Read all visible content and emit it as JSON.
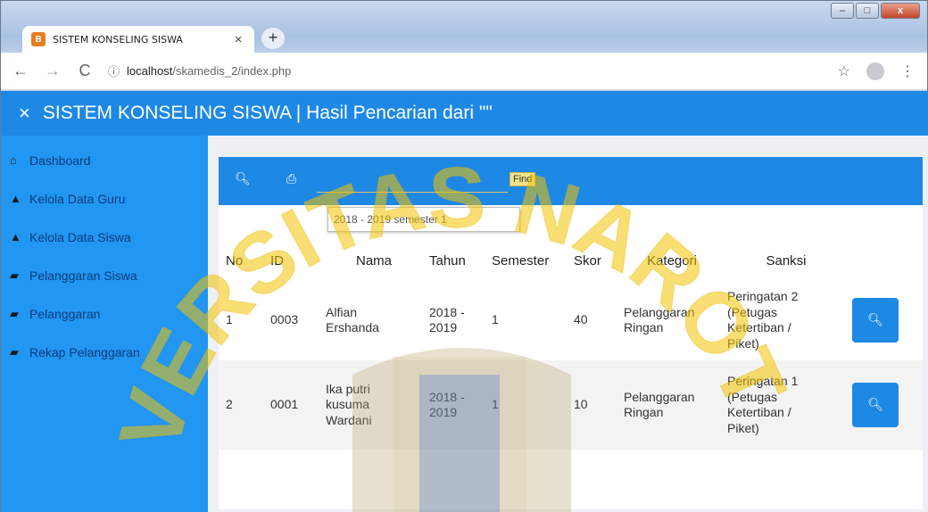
{
  "browser": {
    "tab_title": "SISTEM KONSELING SISWA",
    "tab_close": "×",
    "new_tab": "+",
    "url_host": "localhost",
    "url_path": "/skamedis_2/index.php",
    "win_min": "–",
    "win_max": "□",
    "win_close": "x"
  },
  "app": {
    "close_icon": "×",
    "title": "SISTEM KONSELING SISWA | Hasil Pencarian dari \"\""
  },
  "sidebar": {
    "items": [
      {
        "icon": "home-icon",
        "glyph": "⌂",
        "label": "Dashboard"
      },
      {
        "icon": "user-icon",
        "glyph": "▲",
        "label": "Kelola Data Guru"
      },
      {
        "icon": "user-icon",
        "glyph": "▲",
        "label": "Kelola Data Siswa"
      },
      {
        "icon": "book-icon",
        "glyph": "▰",
        "label": "Pelanggaran Siswa"
      },
      {
        "icon": "book-icon",
        "glyph": "▰",
        "label": "Pelanggaran"
      },
      {
        "icon": "book-icon",
        "glyph": "▰",
        "label": "Rekap Pelanggaran"
      }
    ]
  },
  "search": {
    "value": "",
    "find_label": "Find",
    "suggestion": "2018 - 2019 semester 1"
  },
  "table": {
    "headers": [
      "No",
      "ID",
      "Nama",
      "Tahun",
      "Semester",
      "Skor",
      "Kategori",
      "Sanksi"
    ],
    "rows": [
      {
        "no": "1",
        "id": "0003",
        "nama": "Alfian Ershanda",
        "tahun": "2018 - 2019",
        "semester": "1",
        "skor": "40",
        "kategori": "Pelanggaran Ringan",
        "sanksi": "Peringatan 2 (Petugas Ketertiban / Piket)"
      },
      {
        "no": "2",
        "id": "0001",
        "nama": "Ika putri kusuma Wardani",
        "tahun": "2018 - 2019",
        "semester": "1",
        "skor": "10",
        "kategori": "Pelanggaran Ringan",
        "sanksi": "Peringatan 1 (Petugas Ketertiban / Piket)"
      }
    ]
  },
  "watermark": {
    "text": "UNIVERSITAS NAROTAMA",
    "color": "#f2c200"
  }
}
